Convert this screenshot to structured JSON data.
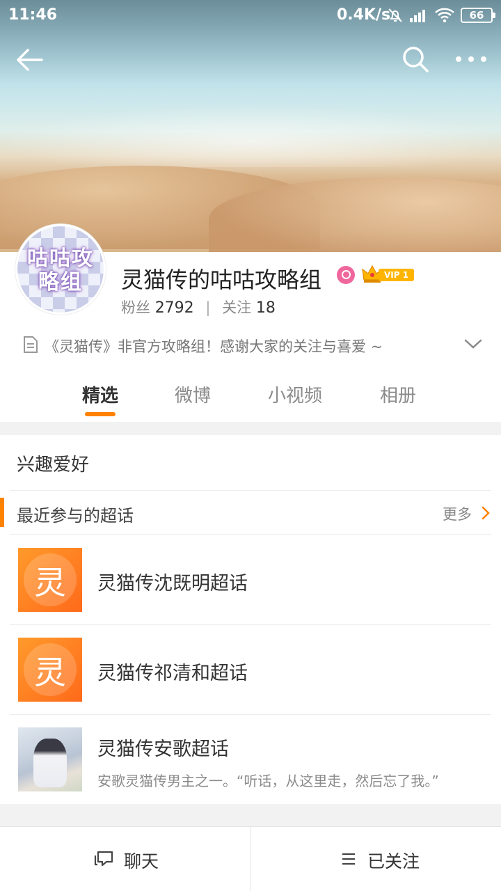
{
  "status_bar": {
    "time": "11:46",
    "network_speed": "0.4K/s",
    "battery": "66"
  },
  "profile": {
    "avatar_text": "咕咕攻略组",
    "name": "灵猫传的咕咕攻略组",
    "vip_label": "VIP 1",
    "fans_label": "粉丝",
    "fans_count": "2792",
    "following_label": "关注",
    "following_count": "18",
    "bio": "《灵猫传》非官方攻略组！感谢大家的关注与喜爱 ~"
  },
  "tabs": [
    {
      "label": "精选",
      "active": true
    },
    {
      "label": "微博",
      "active": false
    },
    {
      "label": "小视频",
      "active": false
    },
    {
      "label": "相册",
      "active": false
    }
  ],
  "section": {
    "title": "兴趣爱好",
    "sub_title": "最近参与的超话",
    "more_label": "更多"
  },
  "topics": [
    {
      "thumb_char": "灵",
      "title": "灵猫传沈既明超话",
      "desc": ""
    },
    {
      "thumb_char": "灵",
      "title": "灵猫传祁清和超话",
      "desc": ""
    },
    {
      "thumb_char": "",
      "title": "灵猫传安歌超话",
      "desc": "安歌灵猫传男主之一。“听话，从这里走，然后忘了我。”"
    }
  ],
  "bottom_bar": {
    "chat_label": "聊天",
    "follow_label": "已关注"
  },
  "colors": {
    "accent": "#ff8200",
    "vip": "#ffb400",
    "badge": "#f0679e"
  }
}
